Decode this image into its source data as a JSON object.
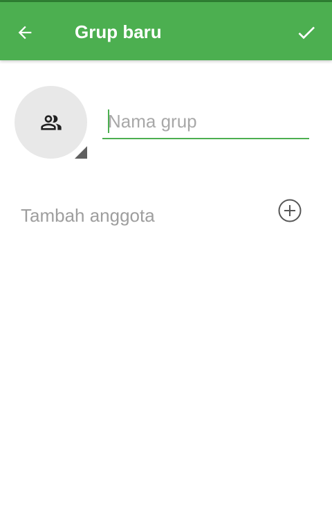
{
  "toolbar": {
    "title": "Grup baru",
    "back_icon": "arrow-back-icon",
    "confirm_icon": "check-icon",
    "color": "#4caf50"
  },
  "group_avatar": {
    "icon": "group-icon",
    "background": "#e8e8e8"
  },
  "group_name": {
    "placeholder": "Nama grup",
    "value": ""
  },
  "add_member": {
    "label": "Tambah anggota",
    "icon": "add-circle-icon"
  }
}
